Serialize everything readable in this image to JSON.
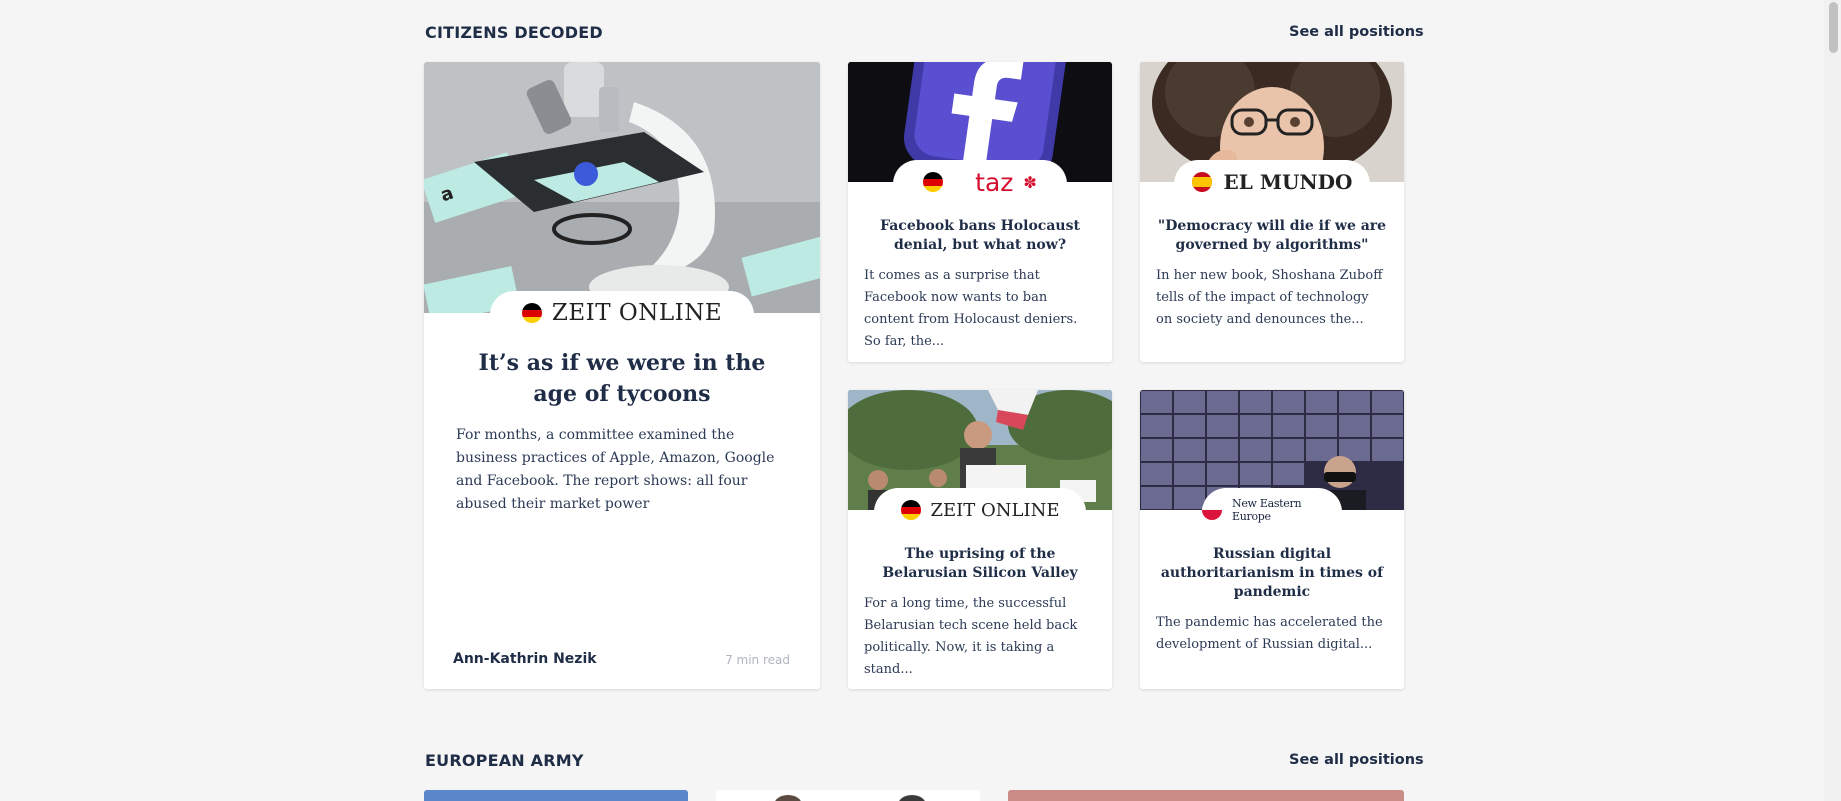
{
  "sections": [
    {
      "title": "CITIZENS DECODED",
      "see_all": "See all positions"
    },
    {
      "title": "EUROPEAN ARMY",
      "see_all": "See all positions"
    }
  ],
  "featured": {
    "source": "ZEIT ONLINE",
    "flag": "de",
    "headline": "It’s as if we were in the age of tycoons",
    "excerpt": "For months, a committee examined the business practices of Apple, Amazon, Google and Facebook. The report shows: all four abused their market power",
    "author": "Ann-Kathrin Nezik",
    "read_time": "7 min read",
    "image_icon": "microscope-icon"
  },
  "cards": [
    {
      "source": "taz",
      "flag": "de",
      "headline": "Facebook bans Holocaust denial, but what now?",
      "excerpt": "It comes as a surprise that Facebook now wants to ban content from Holocaust deniers. So far, the...",
      "image_icon": "facebook-logo-icon"
    },
    {
      "source": "EL MUNDO",
      "flag": "es",
      "headline": "\"Democracy will die if we are governed by algorithms\"",
      "excerpt": "In her new book, Shoshana Zuboff tells of the impact of technology on society and denounces the...",
      "image_icon": "portrait-icon"
    },
    {
      "source": "ZEIT ONLINE",
      "flag": "de",
      "headline": "The uprising of the Belarusian Silicon Valley",
      "excerpt": "For a long time, the successful Belarusian tech scene held back politically. Now, it is taking a stand...",
      "image_icon": "protest-icon"
    },
    {
      "source": "New Eastern Europe",
      "flag": "pl",
      "headline": "Russian digital authoritarianism in times of pandemic",
      "excerpt": "The pandemic has accelerated the development of Russian digital...",
      "image_icon": "video-call-grid-icon"
    }
  ],
  "colors": {
    "background": "#f5f5f5",
    "heading": "#1f2d47",
    "taz_red": "#d50d2e",
    "muted": "#b0b6c0"
  }
}
